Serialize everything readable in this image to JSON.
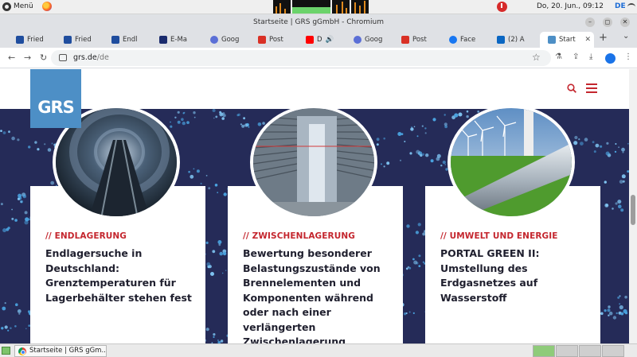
{
  "os": {
    "menu_label": "Menü",
    "clock": "Do, 20. Jun., 09:12",
    "lang": "DE"
  },
  "browser": {
    "window_title": "Startseite | GRS gGmbH - Chromium",
    "win_controls": {
      "minimize": "–",
      "maximize": "◻",
      "close": "✕"
    },
    "tabs": [
      {
        "label": "Fried",
        "fav_color": "#1f4d9e"
      },
      {
        "label": "Fried",
        "fav_color": "#1f4d9e"
      },
      {
        "label": "Endl",
        "fav_color": "#1f4d9e"
      },
      {
        "label": "E-Ma",
        "fav_color": "#1a2b6d"
      },
      {
        "label": "Goog",
        "fav_color": "#5b6fd6"
      },
      {
        "label": "Post",
        "fav_color": "#d93025"
      },
      {
        "label": "D",
        "fav_color": "#ff0000"
      },
      {
        "label": "Goog",
        "fav_color": "#5b6fd6"
      },
      {
        "label": "Post",
        "fav_color": "#d93025"
      },
      {
        "label": "Face",
        "fav_color": "#1877f2"
      },
      {
        "label": "(2) A",
        "fav_color": "#0a66c2"
      },
      {
        "label": "Start",
        "fav_color": "#4d8fc6"
      }
    ],
    "new_tab": "+",
    "tab_scroll": "⌄",
    "url_host": "grs.de",
    "url_path": "/de",
    "nav": {
      "back": "←",
      "forward": "→",
      "reload": "↻"
    },
    "toolbar_icons": {
      "star": "☆",
      "lab": "⚗",
      "share": "⇪",
      "download": "⤓",
      "menu": "⋮"
    }
  },
  "site": {
    "logo_text": "GRS",
    "cards": [
      {
        "category": "// ENDLAGERUNG",
        "title": "Endlagersuche in Deutschland: Grenztemperaturen für Lagerbehälter stehen fest"
      },
      {
        "category": "// ZWISCHENLAGERUNG",
        "title": "Bewertung besonderer Belastungszustände von Brennelementen und Komponenten während oder nach einer verlängerten Zwischenlagerung"
      },
      {
        "category": "// UMWELT UND ENERGIE",
        "title": "PORTAL GREEN II: Umstellung des Erdgasnetzes auf Wasserstoff"
      }
    ],
    "accent": "#c4262e",
    "background": "#252b58"
  },
  "taskbar": {
    "item_label": "Startseite | GRS gGm..."
  }
}
